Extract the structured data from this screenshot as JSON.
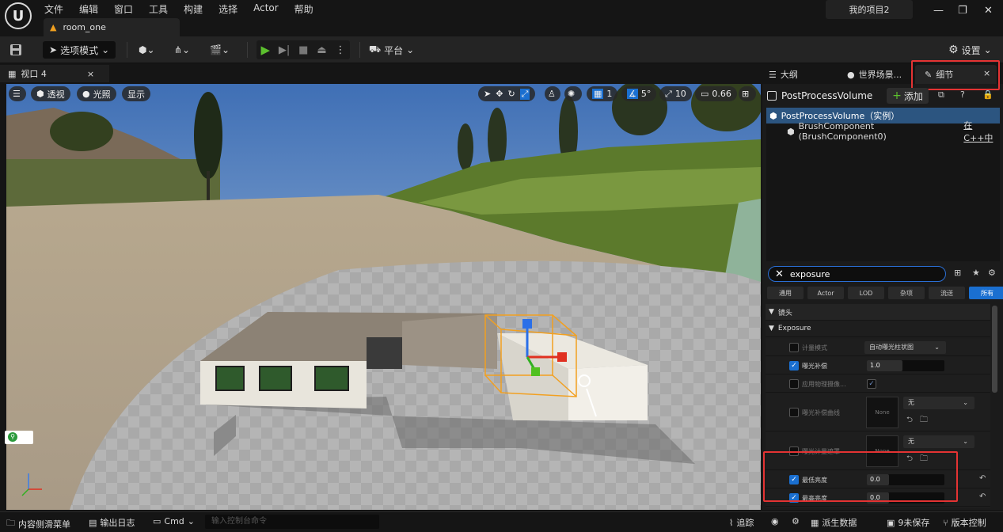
{
  "app": {
    "logo_icon": "unreal-engine-logo",
    "menu": [
      "文件",
      "编辑",
      "窗口",
      "工具",
      "构建",
      "选择",
      "Actor",
      "帮助"
    ],
    "project_name": "我的项目2",
    "level_tab": "room_one"
  },
  "toolbar": {
    "mode_label": "选项模式",
    "platform_label": "平台",
    "settings_label": "设置"
  },
  "viewport": {
    "tab_label": "视口 4",
    "perspective_label": "透视",
    "lighting_label": "光照",
    "show_label": "显示",
    "grid_snap_value": "1",
    "angle_snap_value": "5°",
    "scale_snap_value": "10",
    "camera_speed_value": "0.66"
  },
  "right_panel": {
    "tabs": [
      "大纲",
      "世界场景...",
      "细节"
    ],
    "actor_name": "PostProcessVolume",
    "add_label": "添加",
    "tree": [
      {
        "label": "PostProcessVolume（实例）",
        "selected": true
      },
      {
        "label": "BrushComponent (BrushComponent0)",
        "extra": "在C++中",
        "selected": false
      }
    ],
    "search_value": "exposure",
    "filters": [
      "通用",
      "Actor",
      "LOD",
      "杂项",
      "流送",
      "所有"
    ],
    "active_filter": "所有",
    "categories": {
      "lens": "镜头",
      "exposure": "Exposure"
    },
    "props": {
      "metering_mode": {
        "label": "计量模式",
        "value": "自动曝光柱状图"
      },
      "exposure_comp": {
        "label": "曝光补偿",
        "value": "1.0"
      },
      "physical_cam": {
        "label": "应用物理摄像..."
      },
      "comp_curve": {
        "label": "曝光补偿曲线",
        "value": "无",
        "thumb": "None"
      },
      "meter_mask": {
        "label": "曝光计量遮罩",
        "value": "无",
        "thumb": "None"
      },
      "min_brightness": {
        "label": "最低亮度",
        "value": "0.0"
      },
      "max_brightness": {
        "label": "最高亮度",
        "value": "0.0"
      }
    }
  },
  "bottom_bar": {
    "content_drawer": "内容侧滑菜单",
    "output_log": "输出日志",
    "cmd": "Cmd",
    "cmd_placeholder": "输入控制台命令",
    "trace": "追踪",
    "derived_data": "派生数据",
    "unsaved": "9未保存",
    "source_control": "版本控制"
  }
}
